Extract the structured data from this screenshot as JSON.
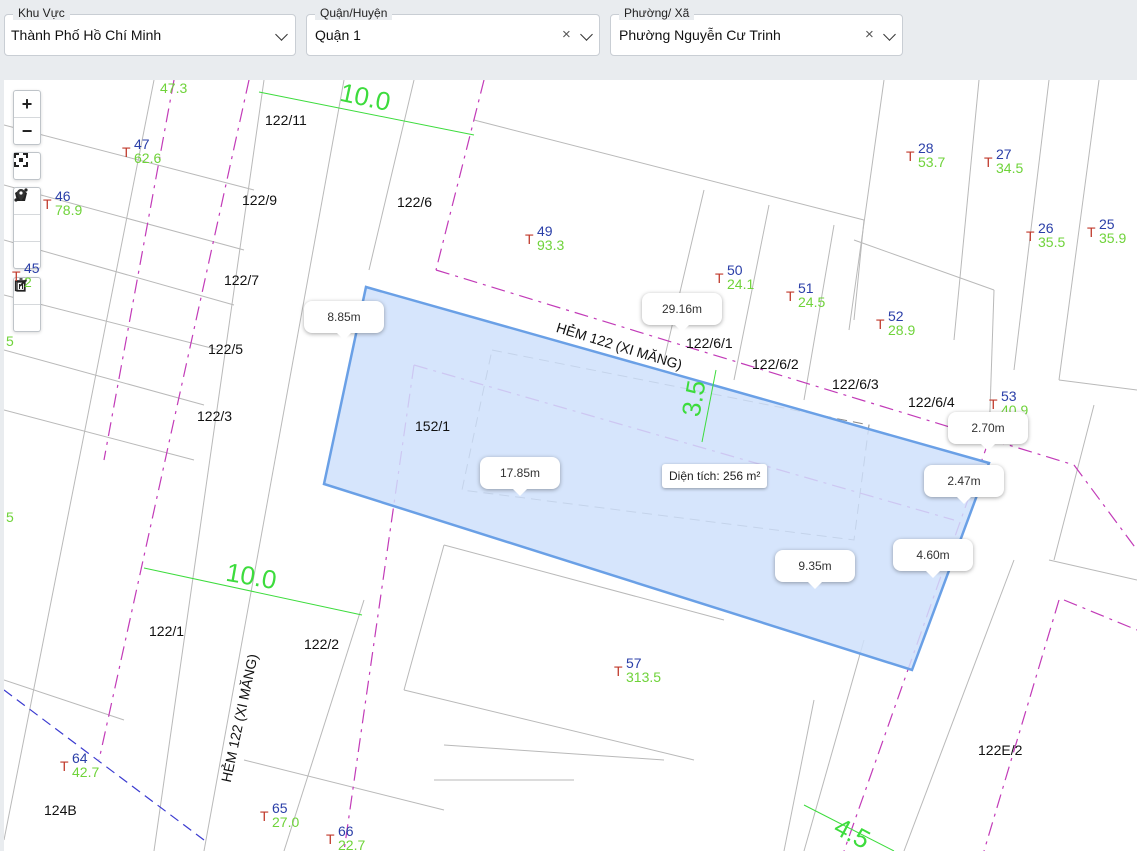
{
  "filters": {
    "area": {
      "label": "Khu Vực",
      "value": "Thành Phố Hồ Chí Minh"
    },
    "district": {
      "label": "Quận/Huyện",
      "value": "Quận 1"
    },
    "ward": {
      "label": "Phường/ Xã",
      "value": "Phường Nguyễn Cư Trinh"
    },
    "clear_symbol": "×"
  },
  "controls": {
    "zoom_in": "+",
    "zoom_out": "−",
    "icons": [
      "fullscreen-icon",
      "measure-line-icon",
      "polygon-icon",
      "marker-icon",
      "edit-icon",
      "trash-icon"
    ]
  },
  "measurements": {
    "area_label": "Diện tích: 256 m²",
    "callouts": [
      "8.85m",
      "29.16m",
      "2.70m",
      "2.47m",
      "17.85m",
      "9.35m",
      "4.60m"
    ]
  },
  "street_labels": {
    "hem_top": "HẺM 122 (XI MĂNG)",
    "hem_left": "HẺM 122 (XI MĂNG)"
  },
  "dimensions": [
    "10.0",
    "10.0",
    "3.5",
    "4.5"
  ],
  "parcel_labels": [
    "122/11",
    "122/9",
    "122/6",
    "122/7",
    "122/5",
    "122/3",
    "152/1",
    "122/6/1",
    "122/6/2",
    "122/6/3",
    "122/6/4",
    "122/1",
    "122/2",
    "122E/2",
    "124B"
  ],
  "lots": [
    {
      "t": "T",
      "num": "47",
      "area": "62.6"
    },
    {
      "t": "T",
      "num": "46",
      "area": "78.9"
    },
    {
      "t": "T",
      "num": "45",
      "area": "2"
    },
    {
      "t": "T",
      "num": "49",
      "area": "93.3"
    },
    {
      "t": "T",
      "num": "50",
      "area": "24.1"
    },
    {
      "t": "T",
      "num": "51",
      "area": "24.5"
    },
    {
      "t": "T",
      "num": "52",
      "area": "28.9"
    },
    {
      "t": "T",
      "num": "28",
      "area": "53.7"
    },
    {
      "t": "T",
      "num": "27",
      "area": "34.5"
    },
    {
      "t": "T",
      "num": "26",
      "area": "35.5"
    },
    {
      "t": "T",
      "num": "25",
      "area": "35.9"
    },
    {
      "t": "T",
      "num": "53",
      "area": "40.9"
    },
    {
      "t": "T",
      "num": "57",
      "area": "313.5"
    },
    {
      "t": "T",
      "num": "64",
      "area": "42.7"
    },
    {
      "t": "T",
      "num": "65",
      "area": "27.0"
    },
    {
      "t": "T",
      "num": "66",
      "area": "22.7"
    }
  ],
  "edge_fragments": [
    "47.3",
    "5",
    "5"
  ],
  "colors": {
    "selection_fill": "#cfe0fb",
    "selection_stroke": "#6aa0e6",
    "lot_number": "#2b3fa8",
    "lot_area": "#6fd33a",
    "lot_t": "#c0392b",
    "boundary": "#c23bb8"
  }
}
